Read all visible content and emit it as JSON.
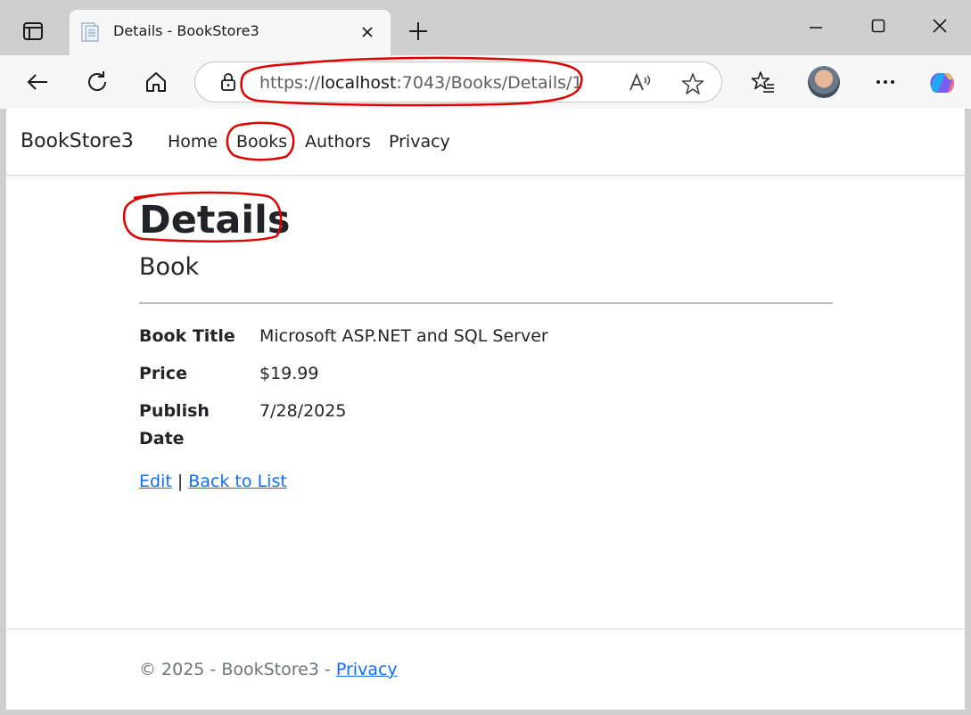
{
  "browser": {
    "tab_title": "Details - BookStore3",
    "url_prefix": "https://",
    "url_host": "localhost",
    "url_path": ":7043/Books/Details/1"
  },
  "navbar": {
    "brand": "BookStore3",
    "links": [
      "Home",
      "Books",
      "Authors",
      "Privacy"
    ]
  },
  "page": {
    "heading": "Details",
    "subheading": "Book",
    "fields": [
      {
        "label": "Book Title",
        "value": "Microsoft ASP.NET and SQL Server"
      },
      {
        "label": "Price",
        "value": "$19.99"
      },
      {
        "label": "Publish Date",
        "value": "7/28/2025"
      }
    ],
    "edit_link": "Edit",
    "separator": "|",
    "back_link": "Back to List"
  },
  "footer": {
    "text": "© 2025 - BookStore3 - ",
    "privacy_link": "Privacy"
  },
  "colors": {
    "link": "#0d6efd",
    "annotation": "#e00000"
  }
}
